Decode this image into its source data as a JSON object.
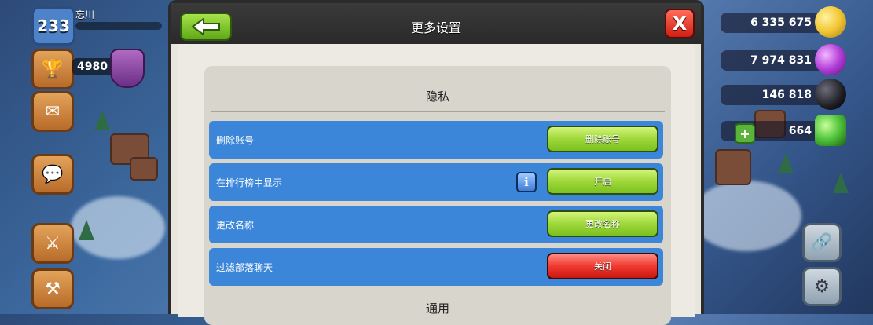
{
  "hud": {
    "level": "233",
    "player_name": "忘川",
    "trophies": "4980",
    "resources": [
      {
        "value": "6 335 675",
        "icon": "gold-coin-icon",
        "color": "#f2c634"
      },
      {
        "value": "7 974 831",
        "icon": "elixir-drop-icon",
        "color": "#b23ed8"
      },
      {
        "value": "146 818",
        "icon": "dark-elixir-icon",
        "color": "#1c1c22"
      },
      {
        "value": "664",
        "icon": "gem-icon",
        "color": "#4fc23a"
      }
    ]
  },
  "dialog": {
    "title": "更多设置",
    "privacy_section": "隐私",
    "general_section": "通用",
    "rows": [
      {
        "label": "删除账号",
        "button": "删除账号",
        "color": "green"
      },
      {
        "label": "在排行榜中显示",
        "button": "开启",
        "color": "green",
        "has_info": true
      },
      {
        "label": "更改名称",
        "button": "更改名称",
        "color": "green"
      },
      {
        "label": "过滤部落聊天",
        "button": "关闭",
        "color": "red"
      }
    ]
  }
}
